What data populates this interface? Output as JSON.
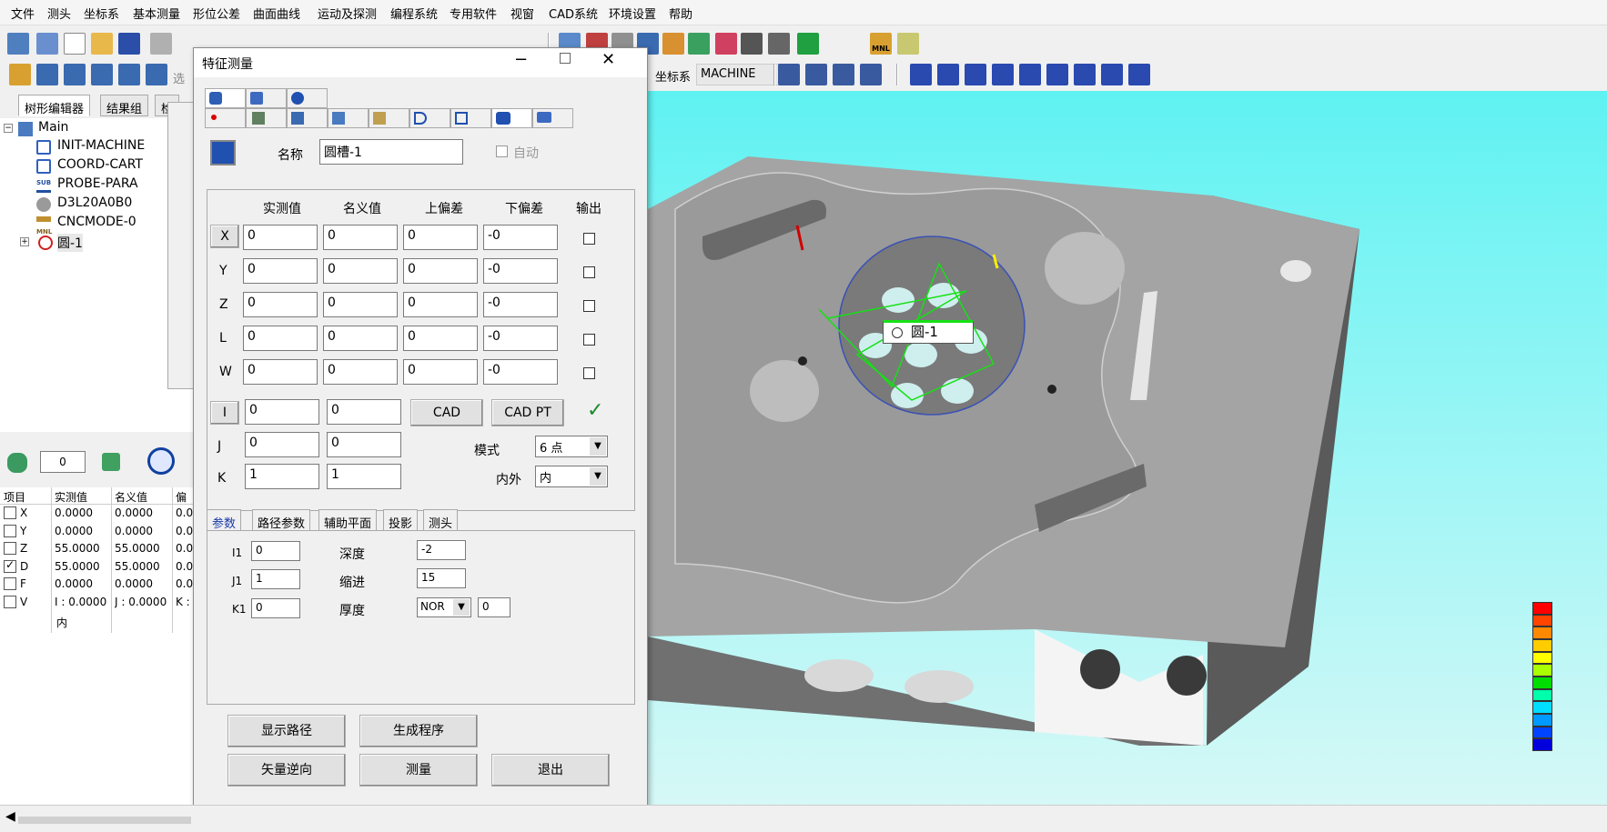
{
  "menu": [
    "文件",
    "测头",
    "坐标系",
    "基本测量",
    "形位公差",
    "曲面曲线",
    "运动及探测",
    "编程系统",
    "专用软件",
    "视窗",
    "CAD系统",
    "环境设置",
    "帮助"
  ],
  "toolbar": {
    "select_label": "选",
    "coord_label": "坐标系",
    "coord_value": "MACHINE",
    "mnl_label": "MNL"
  },
  "left": {
    "tabs": [
      "树形编辑器",
      "结果组",
      "检"
    ],
    "tree": [
      {
        "label": "Main",
        "icon": "program-icon"
      },
      {
        "label": "INIT-MACHINE",
        "icon": "coord-icon"
      },
      {
        "label": "COORD-CART",
        "icon": "coord-icon"
      },
      {
        "label": "PROBE-PARA",
        "icon": "sub-icon"
      },
      {
        "label": "D3L20A0B0",
        "icon": "probe-icon"
      },
      {
        "label": "CNCMODE-0",
        "icon": "mnl-icon"
      },
      {
        "label": "圆-1",
        "icon": "circle-feature-icon"
      }
    ],
    "sub_icon_label": "SUB",
    "mnl_icon_label": "MNL",
    "counter_value": "0",
    "result_table": {
      "headers": [
        "项目",
        "实测值",
        "名义值",
        "偏"
      ],
      "rows": [
        {
          "item": "X",
          "checked": false,
          "actual": "0.0000",
          "nominal": "0.0000",
          "dev": "0.0"
        },
        {
          "item": "Y",
          "checked": false,
          "actual": "0.0000",
          "nominal": "0.0000",
          "dev": "0.0"
        },
        {
          "item": "Z",
          "checked": false,
          "actual": "55.0000",
          "nominal": "55.0000",
          "dev": "0.0"
        },
        {
          "item": "D",
          "checked": true,
          "actual": "55.0000",
          "nominal": "55.0000",
          "dev": "0.0"
        },
        {
          "item": "F",
          "checked": false,
          "actual": "0.0000",
          "nominal": "0.0000",
          "dev": "0.0"
        },
        {
          "item": "V",
          "checked": false,
          "actual": "I : 0.0000",
          "nominal": "J : 0.0000",
          "dev": "K :"
        }
      ],
      "extra_row": "内"
    }
  },
  "dialog": {
    "title": "特征测量",
    "name_label": "名称",
    "name_value": "圆槽-1",
    "auto_label": "自动",
    "columns": [
      "实测值",
      "名义值",
      "上偏差",
      "下偏差",
      "输出"
    ],
    "rows": [
      {
        "label": "X",
        "actual": "0",
        "nominal": "0",
        "upper": "0",
        "lower": "-0"
      },
      {
        "label": "Y",
        "actual": "0",
        "nominal": "0",
        "upper": "0",
        "lower": "-0"
      },
      {
        "label": "Z",
        "actual": "0",
        "nominal": "0",
        "upper": "0",
        "lower": "-0"
      },
      {
        "label": "L",
        "actual": "0",
        "nominal": "0",
        "upper": "0",
        "lower": "-0"
      },
      {
        "label": "W",
        "actual": "0",
        "nominal": "0",
        "upper": "0",
        "lower": "-0"
      }
    ],
    "vec_rows": [
      {
        "label": "I",
        "actual": "0",
        "nominal": "0"
      },
      {
        "label": "J",
        "actual": "0",
        "nominal": "0"
      },
      {
        "label": "K",
        "actual": "1",
        "nominal": "1"
      }
    ],
    "cad_button": "CAD",
    "cadpt_button": "CAD PT",
    "mode_label": "模式",
    "mode_value": "6 点",
    "inout_label": "内外",
    "inout_value": "内",
    "subtabs": [
      "参数",
      "路径参数",
      "辅助平面",
      "投影",
      "测头"
    ],
    "params": {
      "i1_label": "I1",
      "i1_value": "0",
      "j1_label": "J1",
      "j1_value": "1",
      "k1_label": "K1",
      "k1_value": "0",
      "depth_label": "深度",
      "depth_value": "-2",
      "retract_label": "缩进",
      "retract_value": "15",
      "thick_label": "厚度",
      "thick_mode": "NOR",
      "thick_value": "0"
    },
    "buttons": {
      "show_path": "显示路径",
      "gen_prog": "生成程序",
      "reverse": "矢量逆向",
      "measure": "测量",
      "exit": "退出"
    }
  },
  "viewport": {
    "feature_tag": "圆-1",
    "colors": {
      "part": "#9c9c9c",
      "dark": "#5c5c5c",
      "light": "#ffffff",
      "accent_green": "#16e016",
      "scale": [
        "#ff0000",
        "#ff4400",
        "#ff8800",
        "#ffcc00",
        "#ffff00",
        "#aaff00",
        "#00dd00",
        "#00ffaa",
        "#00ddff",
        "#0099ff",
        "#0044ff",
        "#0000dd"
      ]
    }
  }
}
